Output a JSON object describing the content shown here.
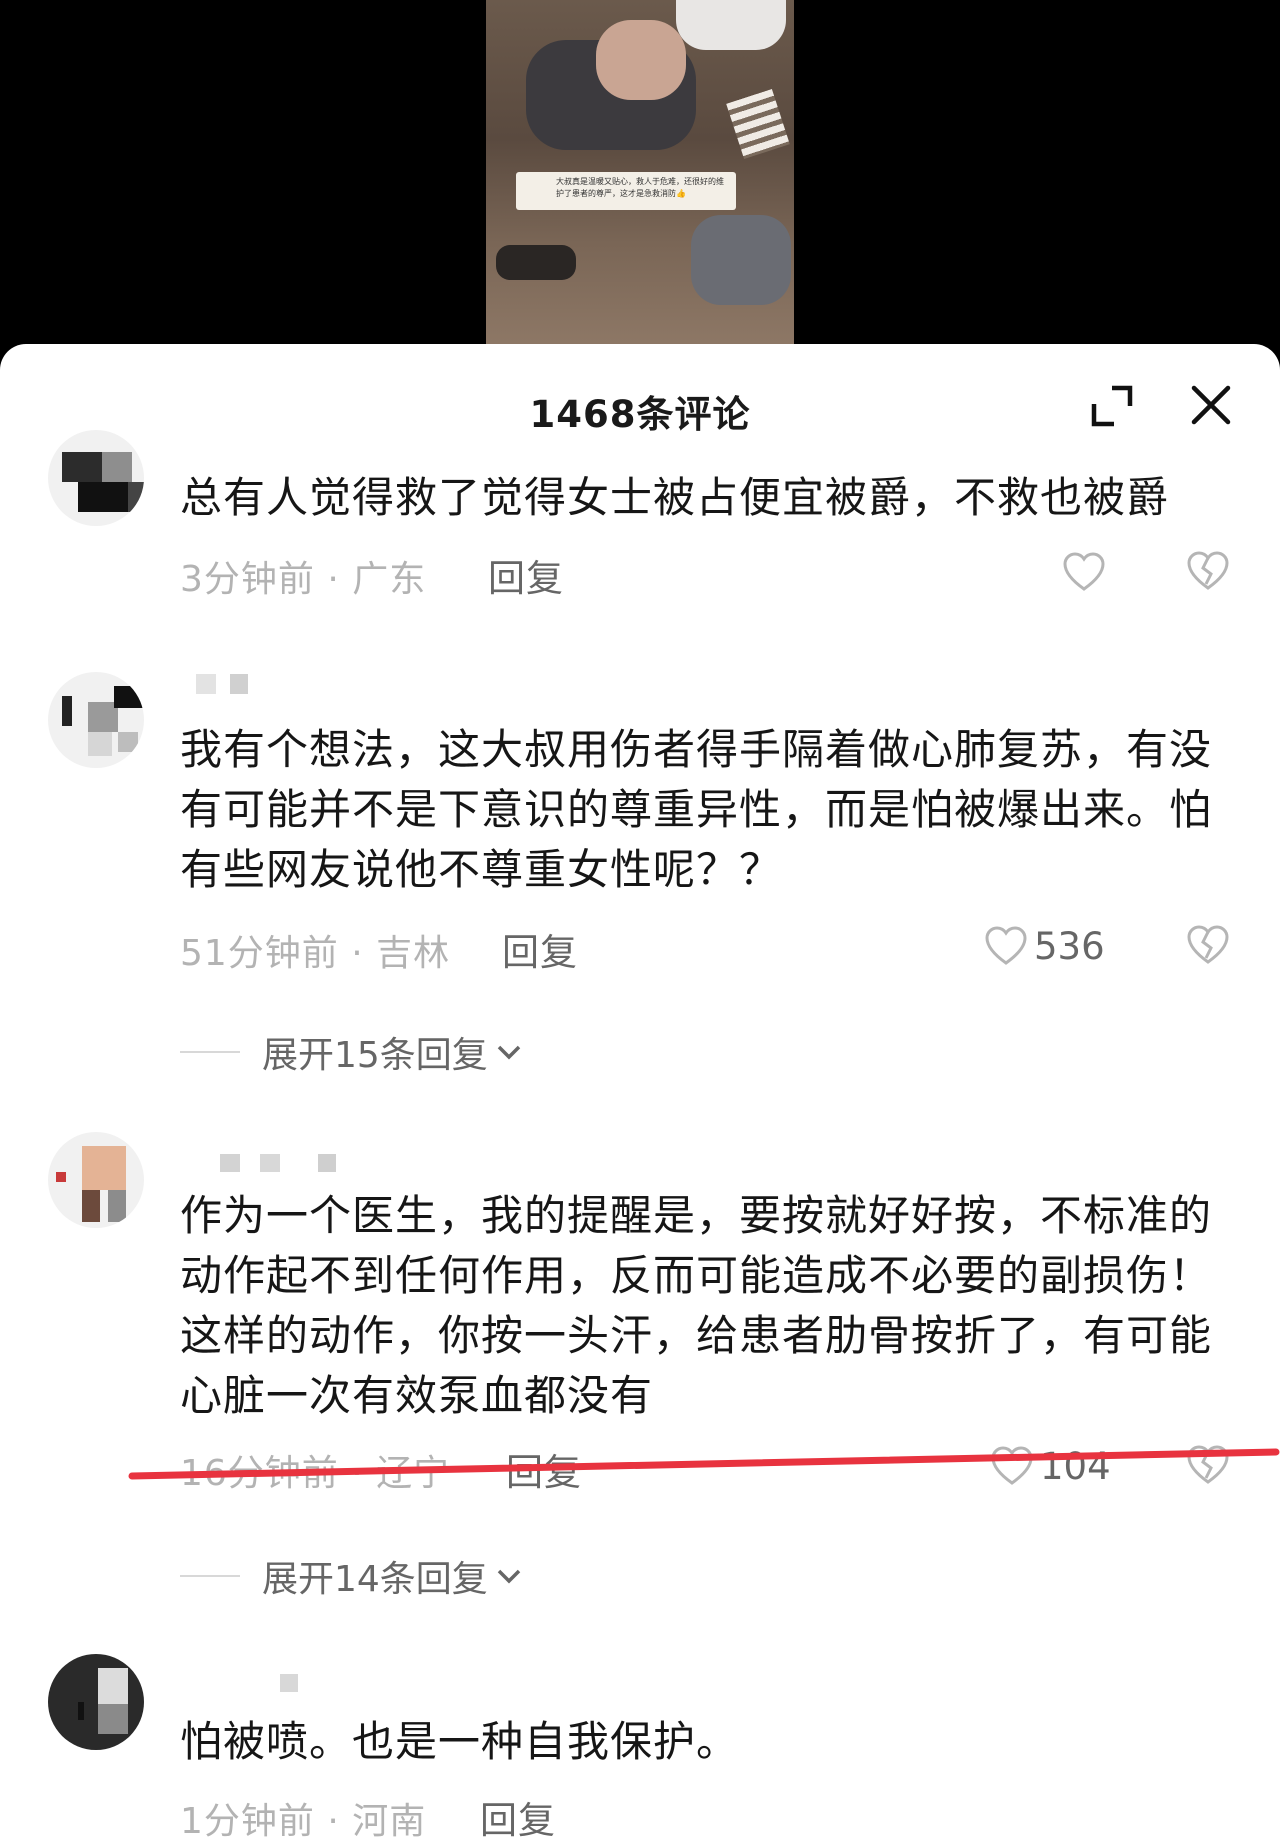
{
  "video": {
    "caption": "大叔真是温暖又贴心，救人于危难，还很好的维护了患者的尊严，这才是急救消防👍"
  },
  "sheet": {
    "title": "1468条评论",
    "expand_icon": "expand-icon",
    "close_icon": "close-icon"
  },
  "comments": [
    {
      "text": "总有人觉得救了觉得女士被占便宜被爵，不救也被爵",
      "time": "3分钟前 · 广东",
      "reply": "回复",
      "likes": ""
    },
    {
      "text": "我有个想法，这大叔用伤者得手隔着做心肺复苏，有没有可能并不是下意识的尊重异性，而是怕被爆出来。怕有些网友说他不尊重女性呢？？",
      "time": "51分钟前 · 吉林",
      "reply": "回复",
      "likes": "536",
      "expand": "展开15条回复"
    },
    {
      "text": "作为一个医生，我的提醒是，要按就好好按，不标准的动作起不到任何作用，反而可能造成不必要的副损伤！这样的动作，你按一头汗，给患者肋骨按折了，有可能心脏一次有效泵血都没有",
      "time": "16分钟前 · 辽宁",
      "reply": "回复",
      "likes": "104",
      "expand": "展开14条回复"
    },
    {
      "text": "怕被喷。也是一种自我保护。",
      "time": "1分钟前 · 河南",
      "reply": "回复",
      "likes": ""
    }
  ],
  "colors": {
    "annotation_red": "#e8333f",
    "text_primary": "#161616",
    "text_meta": "#b3b3b3"
  }
}
